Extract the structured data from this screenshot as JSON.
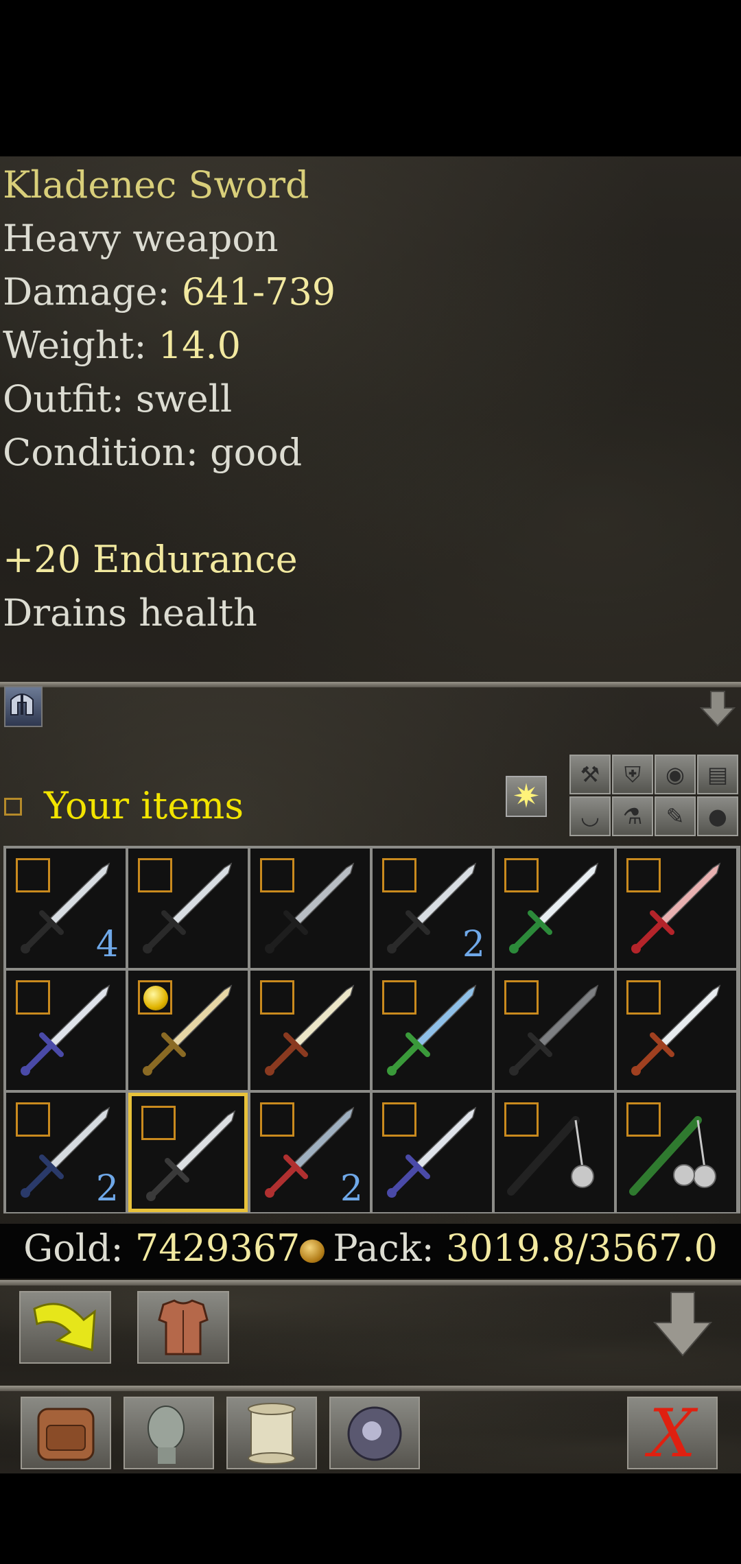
{
  "item_info": {
    "name": "Kladenec Sword",
    "type": "Heavy weapon",
    "damage_label": "Damage: ",
    "damage_value": "641-739",
    "weight_label": "Weight: ",
    "weight_value": "14.0",
    "outfit": "Outfit: swell",
    "condition": "Condition: good",
    "bonus": "+20 Endurance",
    "effect": "Drains health"
  },
  "inventory": {
    "title": "Your items",
    "cells": [
      {
        "icon": "dagger-icon",
        "qty": "4"
      },
      {
        "icon": "dagger-icon",
        "qty": ""
      },
      {
        "icon": "short-sword-icon",
        "qty": ""
      },
      {
        "icon": "dagger-icon",
        "qty": "2"
      },
      {
        "icon": "green-hilt-sword-icon",
        "qty": ""
      },
      {
        "icon": "red-scimitar-icon",
        "qty": ""
      },
      {
        "icon": "twisted-blade-icon",
        "qty": ""
      },
      {
        "icon": "golden-sword-icon",
        "qty": "",
        "marked": true
      },
      {
        "icon": "serrated-sword-icon",
        "qty": ""
      },
      {
        "icon": "crystal-sword-icon",
        "qty": ""
      },
      {
        "icon": "dark-sword-icon",
        "qty": ""
      },
      {
        "icon": "sabre-icon",
        "qty": ""
      },
      {
        "icon": "broad-sword-icon",
        "qty": "2"
      },
      {
        "icon": "kladenec-sword-icon",
        "qty": "",
        "selected": true
      },
      {
        "icon": "jeweled-sword-icon",
        "qty": "2"
      },
      {
        "icon": "twisted-blade-icon",
        "qty": ""
      },
      {
        "icon": "mace-flail-icon",
        "qty": ""
      },
      {
        "icon": "double-flail-icon",
        "qty": ""
      }
    ]
  },
  "status": {
    "gold_label": "Gold: ",
    "gold_value": "7429367",
    "pack_label": "Pack: ",
    "pack_value": "3019.8/3567.0"
  },
  "colors": {
    "accent_yellow": "#f2e400",
    "value_yellow": "#f2e9a0",
    "quantity_blue": "#6fa8e8",
    "selection_gold": "#e8c23a",
    "close_red": "#e02010"
  },
  "toolbar": {
    "buttons": [
      "backpack-icon",
      "character-head-icon",
      "scroll-icon",
      "crystal-orb-icon"
    ],
    "close_label": "X"
  }
}
